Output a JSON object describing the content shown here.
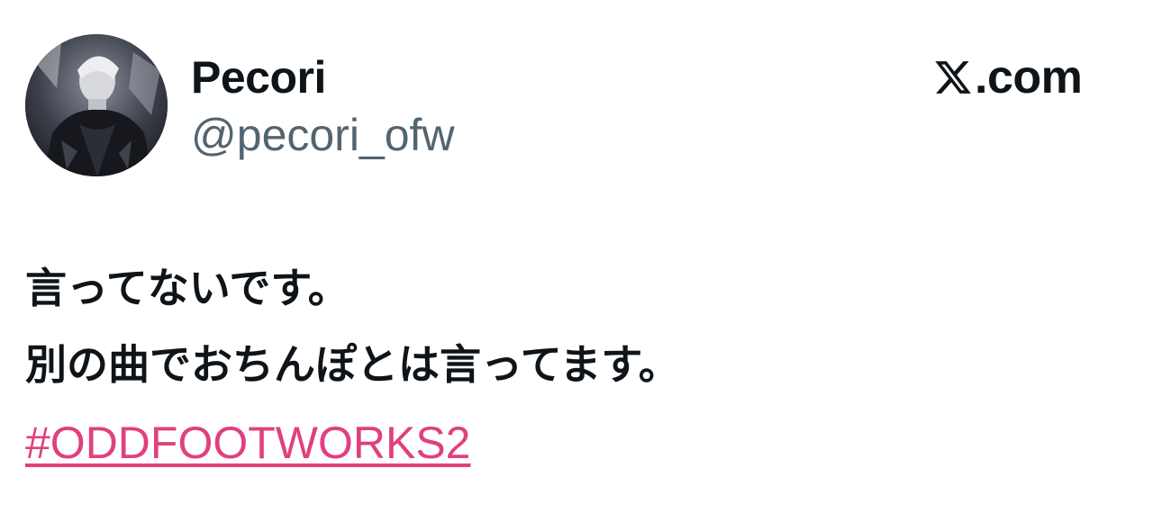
{
  "author": {
    "display_name": "Pecori",
    "handle": "@pecori_ofw",
    "avatar_icon": "profile-photo"
  },
  "brand": {
    "label": ".com",
    "icon": "x-logo-icon"
  },
  "tweet": {
    "lines": [
      "言ってないです。",
      "別の曲でおちんぽとは言ってます。"
    ],
    "hashtag": "#ODDFOOTWORKS2"
  },
  "colors": {
    "text": "#0f1419",
    "handle": "#536471",
    "hashtag": "#e0407f",
    "background": "#ffffff"
  }
}
